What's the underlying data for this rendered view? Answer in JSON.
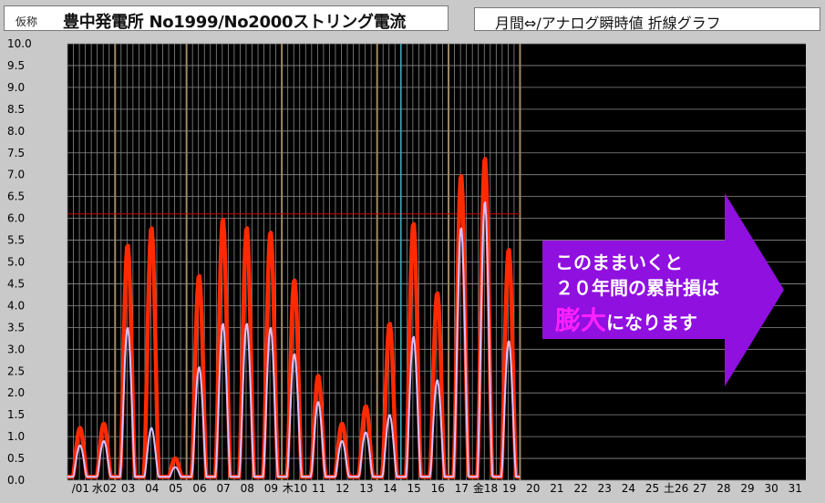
{
  "header": {
    "tag": "仮称",
    "title": "豊中発電所 No1999/No2000ストリング電流",
    "mode": "月間⇔/アナログ瞬時値 折線グラフ"
  },
  "callout": {
    "line1": "このままいくと",
    "line2": "２０年間の累計損は",
    "line3_big": "膨大",
    "line3_rest": "になります"
  },
  "colors": {
    "background": "#000000",
    "grid": "#8a8a8a",
    "day_separator": "#a08a68",
    "series_red": "#ff2a00",
    "series_lavender": "#d8c0ff",
    "threshold": "#cc0000",
    "cursor": "#40b0c0",
    "arrow": "#9010e0"
  },
  "chart_data": {
    "type": "line",
    "ylim": [
      0,
      10
    ],
    "yticks": [
      "0.0",
      "0.5",
      "1.0",
      "1.5",
      "2.0",
      "2.5",
      "3.0",
      "3.5",
      "4.0",
      "4.5",
      "5.0",
      "5.5",
      "6.0",
      "6.5",
      "7.0",
      "7.5",
      "8.0",
      "8.5",
      "9.0",
      "9.5",
      "10.0"
    ],
    "x_labels": [
      "/01",
      "水02",
      "03",
      "04",
      "05",
      "06",
      "07",
      "08",
      "09",
      "木10",
      "11",
      "12",
      "13",
      "14",
      "15",
      "16",
      "17",
      "金18",
      "19",
      "20",
      "21",
      "22",
      "23",
      "24",
      "25",
      "土26",
      "27",
      "28",
      "29",
      "30",
      "31"
    ],
    "threshold": 6.1,
    "cursor_day": 15,
    "series": [
      {
        "day_peaks": [
          1.2,
          1.3,
          5.4,
          5.8,
          0.5,
          4.7,
          6.0,
          5.8,
          5.7,
          4.6,
          2.4,
          1.3,
          1.7,
          3.6,
          5.9,
          4.3,
          7.0,
          7.4,
          5.3
        ]
      },
      {
        "day_peaks": [
          0.8,
          0.9,
          3.5,
          1.2,
          0.3,
          2.6,
          3.6,
          3.6,
          3.5,
          2.9,
          1.8,
          0.9,
          1.1,
          1.5,
          3.3,
          2.3,
          5.8,
          6.4,
          3.2
        ]
      }
    ]
  }
}
